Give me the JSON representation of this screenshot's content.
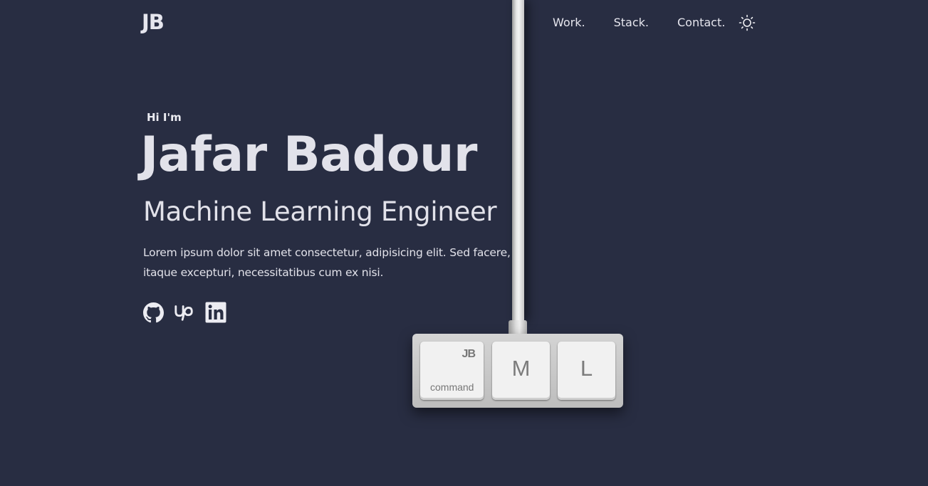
{
  "colors": {
    "background": "#282d42",
    "text": "#e6e6ee",
    "key_face": "#f1f1f1",
    "key_text": "#7c7c7c"
  },
  "header": {
    "logo": "JB",
    "nav": [
      "Work.",
      "Stack.",
      "Contact."
    ],
    "theme_toggle_icon": "sun-icon"
  },
  "hero": {
    "greeting": "Hi I'm",
    "name": "Jafar Badour",
    "role": "Machine Learning Engineer",
    "blurb": "Lorem ipsum dolor sit amet consectetur, adipisicing elit. Sed facere, itaque excepturi, necessitatibus cum ex nisi.",
    "socials": [
      "github-icon",
      "upwork-icon",
      "linkedin-icon"
    ]
  },
  "keyboard": {
    "keys": [
      {
        "logo": "JB",
        "label": "command"
      },
      {
        "label": "M"
      },
      {
        "label": "L"
      }
    ]
  }
}
